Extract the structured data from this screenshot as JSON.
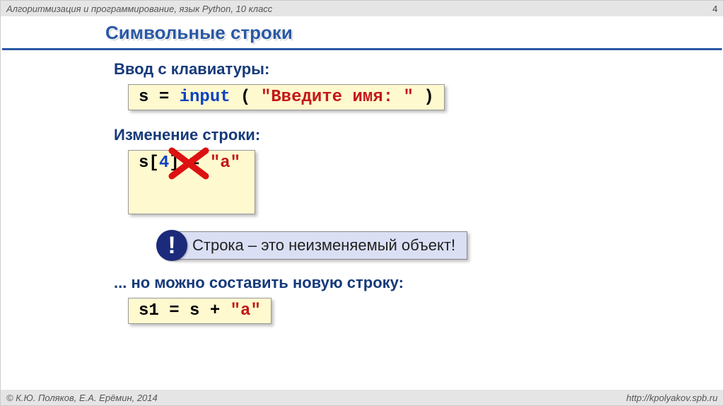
{
  "header": {
    "course": "Алгоритмизация и программирование, язык Python, 10 класс",
    "page_number": "4"
  },
  "slide_title": "Символьные строки",
  "section1": {
    "heading": "Ввод с клавиатуры:",
    "code": {
      "s": "s",
      "eq": "=",
      "input": "input",
      "lp": "(",
      "prompt": "\"Введите имя: \"",
      "rp": ")"
    }
  },
  "section2": {
    "heading": "Изменение строки:",
    "code": {
      "s": "s",
      "lb": "[",
      "idx": "4",
      "rb": "]",
      "eq": "=",
      "val": "\"a\""
    }
  },
  "callout": {
    "bang": "!",
    "text": "Строка – это неизменяемый объект!"
  },
  "section3": {
    "heading": "... но можно составить новую строку:",
    "code": {
      "s1": "s1",
      "eq": "=",
      "s": "s",
      "plus": "+",
      "val": "\"a\""
    }
  },
  "footer": {
    "copyright": "© К.Ю. Поляков, Е.А. Ерёмин, 2014",
    "url": "http://kpolyakov.spb.ru"
  }
}
